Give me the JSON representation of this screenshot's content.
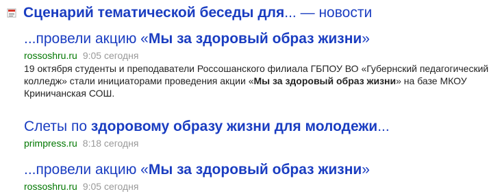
{
  "header": {
    "title_bold": "Сценарий тематической беседы для",
    "title_ellipsis": "...",
    "title_suffix": " — новости"
  },
  "items": [
    {
      "title_prefix": "...провели акцию «",
      "title_bold": "Мы за здоровый образ жизни",
      "title_suffix": "»",
      "source": "rossoshru.ru",
      "time": "9:05 сегодня",
      "snippet_part1": "19 октября студенты и преподаватели Россошанского филиала ГБПОУ ВО «Губернский педагогический колледж» стали инициаторами проведения акции «",
      "snippet_bold": "Мы за здоровый образ жизни",
      "snippet_part2": "» на базе МКОУ Криничанская СОШ."
    },
    {
      "title_prefix": "Слеты по ",
      "title_bold": "здоровому образу жизни для молодежи",
      "title_suffix": "...",
      "source": "primpress.ru",
      "time": "8:18 сегодня"
    },
    {
      "title_prefix": "...провели акцию «",
      "title_bold": "Мы за здоровый образ жизни",
      "title_suffix": "»",
      "source": "rossoshru.ru",
      "time": "9:05 сегодня"
    }
  ],
  "colors": {
    "link": "#1a3dc1",
    "source": "#007700",
    "time": "#999999",
    "text": "#222222"
  }
}
